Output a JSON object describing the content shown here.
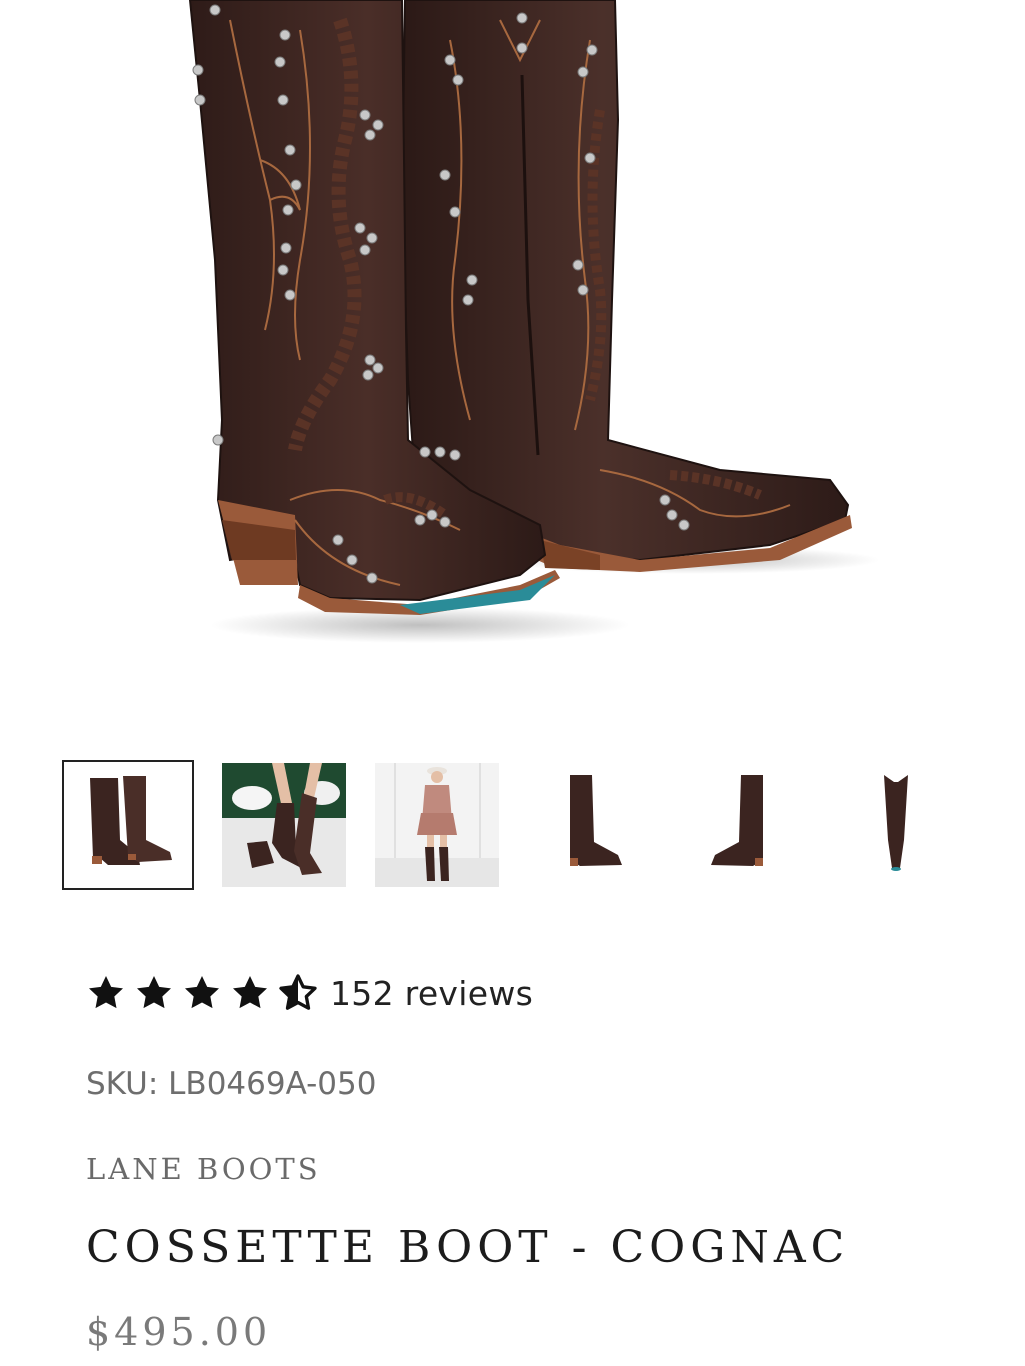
{
  "product": {
    "sku_text": "SKU: LB0469A-050",
    "brand": "LANE BOOTS",
    "title": "COSSETTE BOOT - COGNAC",
    "price": "$495.00"
  },
  "rating": {
    "value": 4.5,
    "max": 5,
    "reviews_text": "152 reviews"
  },
  "gallery": {
    "thumbnail_count": 6,
    "selected_index": 0,
    "thumbnails": [
      {
        "icon": "boot-pair-icon"
      },
      {
        "icon": "boots-lifestyle-icon"
      },
      {
        "icon": "model-in-boots-icon"
      },
      {
        "icon": "boot-side-left-icon"
      },
      {
        "icon": "boot-side-right-icon"
      },
      {
        "icon": "boot-front-icon"
      }
    ]
  },
  "colors": {
    "leather": "#3b2420",
    "sole": "#9a5a3a",
    "turquoise": "#2a8c98",
    "stud": "#c8c8c8",
    "text_primary": "#1c1c1c",
    "text_secondary": "#6e6e6e"
  }
}
